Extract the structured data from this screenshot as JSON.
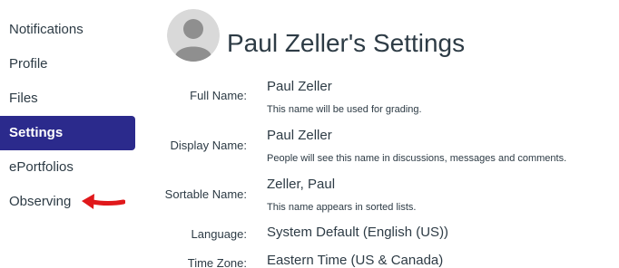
{
  "sidebar": {
    "items": [
      {
        "label": "Notifications",
        "active": false
      },
      {
        "label": "Profile",
        "active": false
      },
      {
        "label": "Files",
        "active": false
      },
      {
        "label": "Settings",
        "active": true
      },
      {
        "label": "ePortfolios",
        "active": false
      },
      {
        "label": "Observing",
        "active": false
      }
    ],
    "active_color": "#2b2a8c",
    "annotation_arrow_color": "#e0181b"
  },
  "header": {
    "title": "Paul Zeller's Settings",
    "avatar_icon": "user-avatar-icon"
  },
  "fields": {
    "full_name": {
      "label": "Full Name:",
      "value": "Paul Zeller",
      "hint": "This name will be used for grading."
    },
    "display_name": {
      "label": "Display Name:",
      "value": "Paul Zeller",
      "hint": "People will see this name in discussions, messages and comments."
    },
    "sortable_name": {
      "label": "Sortable Name:",
      "value": "Zeller, Paul",
      "hint": "This name appears in sorted lists."
    },
    "language": {
      "label": "Language:",
      "value": "System Default (English (US))"
    },
    "time_zone": {
      "label": "Time Zone:",
      "value": "Eastern Time (US & Canada)"
    }
  }
}
